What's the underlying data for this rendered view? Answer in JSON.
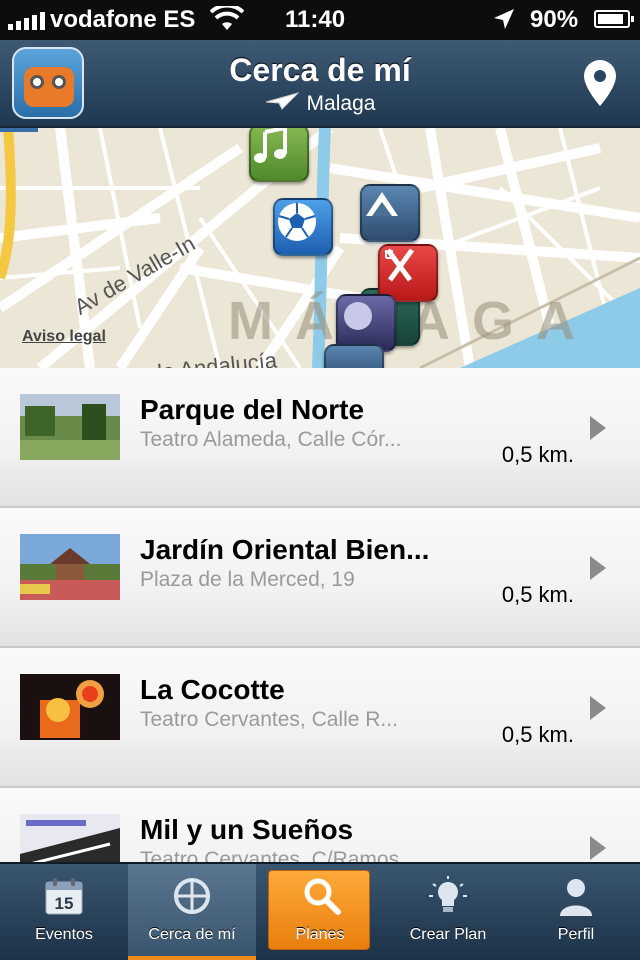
{
  "status_bar": {
    "carrier": "vodafone ES",
    "time": "11:40",
    "battery": "90%",
    "battery_level": 0.9
  },
  "header": {
    "title": "Cerca de mí",
    "location": "Malaga"
  },
  "map": {
    "road_label": "Av de Valle-In",
    "road_label_2": "de Andalucía",
    "city_label": "MÁLAGA",
    "legal_link": "Aviso legal",
    "poi_icons": [
      "music-icon",
      "football-icon",
      "culture-icon",
      "restaurant-icon",
      "nightlife-icon",
      "nightlife-icon",
      "culture-icon"
    ]
  },
  "list": {
    "items": [
      {
        "title": "Parque del Norte",
        "address": "Teatro Alameda, Calle Cór...",
        "distance": "0,5 km."
      },
      {
        "title": "Jardín Oriental Bien...",
        "address": "Plaza de la Merced, 19",
        "distance": "0,5 km."
      },
      {
        "title": "La Cocotte",
        "address": "Teatro Cervantes, Calle R...",
        "distance": "0,5 km."
      },
      {
        "title": "Mil y un Sueños",
        "address": "Teatro Cervantes, C/Ramos...",
        "distance": ""
      }
    ]
  },
  "tabs": [
    {
      "label": "Eventos",
      "icon": "calendar-icon",
      "calendar_day": "15"
    },
    {
      "label": "Cerca de mí",
      "icon": "crosshair-icon"
    },
    {
      "label": "Planes",
      "icon": "search-icon"
    },
    {
      "label": "Crear Plan",
      "icon": "lightbulb-icon"
    },
    {
      "label": "Perfil",
      "icon": "person-icon"
    }
  ],
  "colors": {
    "accent": "#f08a1a",
    "nav": "#2a4662"
  }
}
